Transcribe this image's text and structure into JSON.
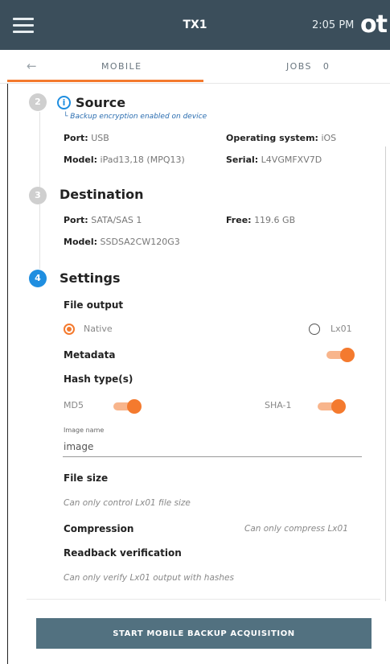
{
  "header": {
    "title": "TX1",
    "time": "2:05 PM",
    "brand": "ot"
  },
  "tabs": {
    "mobile": "MOBILE",
    "jobs": "JOBS",
    "jobs_count": "0"
  },
  "source": {
    "step": "2",
    "title": "Source",
    "note": "└ Backup encryption enabled on device",
    "port_label": "Port:",
    "port_value": "USB",
    "os_label": "Operating system:",
    "os_value": "iOS",
    "model_label": "Model:",
    "model_value": "iPad13,18 (MPQ13)",
    "serial_label": "Serial:",
    "serial_value": "L4VGMFXV7D"
  },
  "destination": {
    "step": "3",
    "title": "Destination",
    "port_label": "Port:",
    "port_value": "SATA/SAS 1",
    "free_label": "Free:",
    "free_value": "119.6 GB",
    "model_label": "Model:",
    "model_value": "SSDSA2CW120G3"
  },
  "settings": {
    "step": "4",
    "title": "Settings",
    "file_output_label": "File output",
    "native_label": "Native",
    "lx01_label": "Lx01",
    "selected_output": "Native",
    "metadata_label": "Metadata",
    "metadata_on": true,
    "hash_types_label": "Hash type(s)",
    "md5_label": "MD5",
    "md5_on": true,
    "sha1_label": "SHA-1",
    "sha1_on": true,
    "image_name_label": "Image name",
    "image_name_value": "image",
    "file_size_label": "File size",
    "file_size_note": "Can only control Lx01 file size",
    "compression_label": "Compression",
    "compression_note": "Can only compress Lx01",
    "readback_label": "Readback verification",
    "readback_note": "Can only verify Lx01 output with hashes"
  },
  "actions": {
    "start_label": "START MOBILE BACKUP ACQUISITION"
  },
  "colors": {
    "header_bg": "#3b4e5b",
    "accent": "#f47a2e",
    "active_step": "#1f8ee0",
    "button_bg": "#527180"
  }
}
